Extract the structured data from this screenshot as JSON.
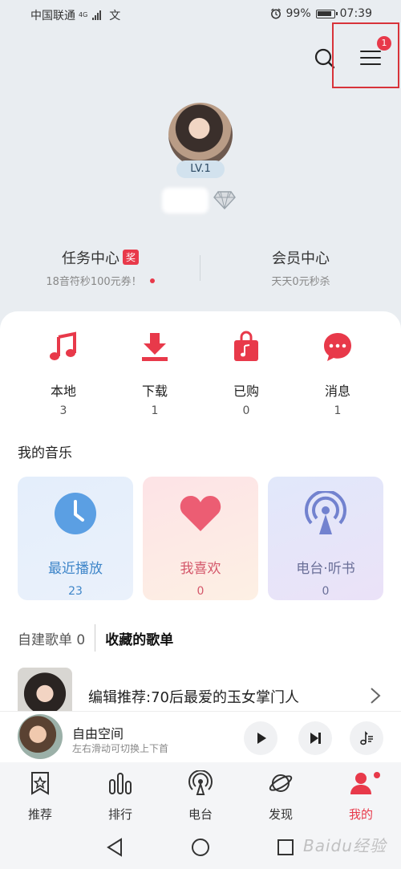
{
  "status_bar": {
    "carrier": "中国联通",
    "network": "4G",
    "extra_icon": "文",
    "battery": "99%",
    "time": "07:39"
  },
  "header": {
    "menu_badge": "1"
  },
  "profile": {
    "level": "LV.1"
  },
  "task_center": {
    "title": "任务中心",
    "badge": "奖",
    "subtitle": "18音符秒100元券！"
  },
  "vip_center": {
    "title": "会员中心",
    "subtitle": "天天0元秒杀"
  },
  "quick_actions": [
    {
      "label": "本地",
      "count": "3",
      "icon": "music-note-icon"
    },
    {
      "label": "下载",
      "count": "1",
      "icon": "download-icon"
    },
    {
      "label": "已购",
      "count": "0",
      "icon": "shopping-bag-icon"
    },
    {
      "label": "消息",
      "count": "1",
      "icon": "message-icon"
    }
  ],
  "my_music": {
    "title": "我的音乐",
    "tiles": [
      {
        "label": "最近播放",
        "count": "23",
        "icon": "clock-icon",
        "color": "#4f93d6"
      },
      {
        "label": "我喜欢",
        "count": "0",
        "icon": "heart-icon",
        "color": "#e4566b"
      },
      {
        "label": "电台·听书",
        "count": "0",
        "icon": "radio-icon",
        "color": "#6f7fc7"
      }
    ]
  },
  "playlist_tabs": {
    "created": "自建歌单 0",
    "collected": "收藏的歌单"
  },
  "playlist_item": {
    "title": "编辑推荐:70后最爱的玉女掌门人"
  },
  "player": {
    "title": "自由空间",
    "subtitle": "左右滑动可切换上下首"
  },
  "bottom_nav": [
    {
      "label": "推荐",
      "icon": "star-bookmark-icon"
    },
    {
      "label": "排行",
      "icon": "bar-chart-icon"
    },
    {
      "label": "电台",
      "icon": "radio-icon"
    },
    {
      "label": "发现",
      "icon": "planet-icon"
    },
    {
      "label": "我的",
      "icon": "user-icon",
      "active": true
    }
  ],
  "watermark": "Baidu经验",
  "colors": {
    "accent": "#e8394a",
    "highlight_box": "#d8333a"
  }
}
